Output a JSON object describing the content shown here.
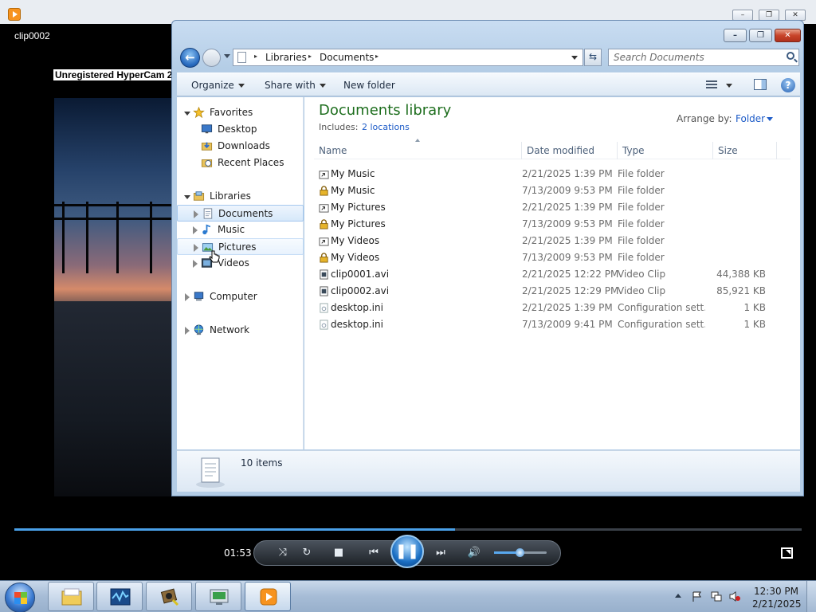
{
  "media_player": {
    "clip_title": "clip0002",
    "watermark": "Unregistered HyperCam 2",
    "elapsed_time": "01:53",
    "seek_progress": 0.56,
    "volume_level": 0.5,
    "controls": {
      "shuffle": "⤨",
      "repeat": "↻",
      "stop": "■",
      "previous": "⏮",
      "play_pause": "❚❚",
      "next": "⏭",
      "mute": "🔊"
    },
    "window_buttons": {
      "minimize": "–",
      "maximize": "❐",
      "close": "✕"
    }
  },
  "explorer": {
    "window_buttons": {
      "minimize": "–",
      "maximize": "❐",
      "close": "✕"
    },
    "back_glyph": "←",
    "refresh_glyph": "⇆",
    "help_glyph": "?",
    "address": {
      "crumbs": [
        "Libraries",
        "Documents"
      ],
      "separator": "▸"
    },
    "search": {
      "placeholder": "Search Documents"
    },
    "commands": {
      "organize": "Organize",
      "share_with": "Share with",
      "new_folder": "New folder"
    },
    "nav": {
      "favorites": "Favorites",
      "desktop": "Desktop",
      "downloads": "Downloads",
      "recent_places": "Recent Places",
      "libraries": "Libraries",
      "documents": "Documents",
      "music": "Music",
      "pictures": "Pictures",
      "videos": "Videos",
      "computer": "Computer",
      "network": "Network"
    },
    "library": {
      "title": "Documents library",
      "includes_label": "Includes:",
      "includes_link": "2 locations",
      "arrange_label": "Arrange by:",
      "arrange_value": "Folder"
    },
    "columns": {
      "name": "Name",
      "date": "Date modified",
      "type": "Type",
      "size": "Size"
    },
    "files": [
      {
        "name": "My Music",
        "date": "2/21/2025 1:39 PM",
        "type": "File folder",
        "size": "",
        "icon": "shortcut-folder-icon"
      },
      {
        "name": "My Music",
        "date": "7/13/2009 9:53 PM",
        "type": "File folder",
        "size": "",
        "icon": "locked-folder-icon"
      },
      {
        "name": "My Pictures",
        "date": "2/21/2025 1:39 PM",
        "type": "File folder",
        "size": "",
        "icon": "shortcut-folder-icon"
      },
      {
        "name": "My Pictures",
        "date": "7/13/2009 9:53 PM",
        "type": "File folder",
        "size": "",
        "icon": "locked-folder-icon"
      },
      {
        "name": "My Videos",
        "date": "2/21/2025 1:39 PM",
        "type": "File folder",
        "size": "",
        "icon": "shortcut-folder-icon"
      },
      {
        "name": "My Videos",
        "date": "7/13/2009 9:53 PM",
        "type": "File folder",
        "size": "",
        "icon": "locked-folder-icon"
      },
      {
        "name": "clip0001.avi",
        "date": "2/21/2025 12:22 PM",
        "type": "Video Clip",
        "size": "44,388 KB",
        "icon": "video-file-icon"
      },
      {
        "name": "clip0002.avi",
        "date": "2/21/2025 12:29 PM",
        "type": "Video Clip",
        "size": "85,921 KB",
        "icon": "video-file-icon"
      },
      {
        "name": "desktop.ini",
        "date": "2/21/2025 1:39 PM",
        "type": "Configuration sett...",
        "size": "1 KB",
        "icon": "config-file-icon"
      },
      {
        "name": "desktop.ini",
        "date": "7/13/2009 9:41 PM",
        "type": "Configuration sett...",
        "size": "1 KB",
        "icon": "config-file-icon"
      }
    ],
    "status": {
      "items_count": "10 items"
    }
  },
  "taskbar": {
    "buttons": [
      "file-explorer",
      "performance-monitor",
      "hypercam",
      "network-tool",
      "media-player"
    ],
    "clock": {
      "time": "12:30 PM",
      "date": "2/21/2025"
    }
  },
  "colors": {
    "library_title": "#1e6e1e",
    "link": "#1e5cc8",
    "seek_fill": "#4aa0e8"
  }
}
